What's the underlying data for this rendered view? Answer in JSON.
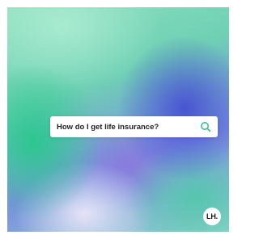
{
  "search": {
    "query": "How do I get life insurance?",
    "icon": "search-icon",
    "icon_color": "#3dbf8f"
  },
  "brand": {
    "logo_text": "LH."
  },
  "colors": {
    "background_green": "#2ec88c",
    "background_blue": "#4650d2",
    "background_mint": "#aaebd2"
  }
}
